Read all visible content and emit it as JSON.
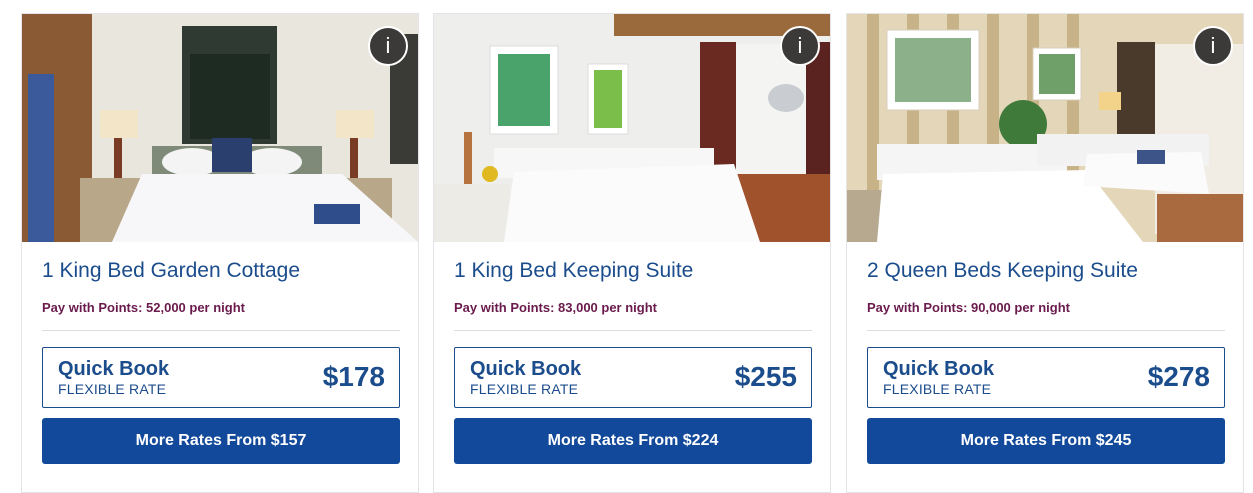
{
  "info_icon_glyph": "i",
  "colors": {
    "title": "#1b4c8c",
    "points": "#6a1a4c",
    "button_bg": "#12499a"
  },
  "rooms": [
    {
      "title": "1 King Bed Garden Cottage",
      "points": "Pay with Points: 52,000 per night",
      "quick_book_label": "Quick Book",
      "rate_label": "FLEXIBLE RATE",
      "price": "$178",
      "more_rates_label": "More Rates From $157"
    },
    {
      "title": "1 King Bed Keeping Suite",
      "points": "Pay with Points: 83,000 per night",
      "quick_book_label": "Quick Book",
      "rate_label": "FLEXIBLE RATE",
      "price": "$255",
      "more_rates_label": "More Rates From $224"
    },
    {
      "title": "2 Queen Beds Keeping Suite",
      "points": "Pay with Points: 90,000 per night",
      "quick_book_label": "Quick Book",
      "rate_label": "FLEXIBLE RATE",
      "price": "$278",
      "more_rates_label": "More Rates From $245"
    }
  ]
}
